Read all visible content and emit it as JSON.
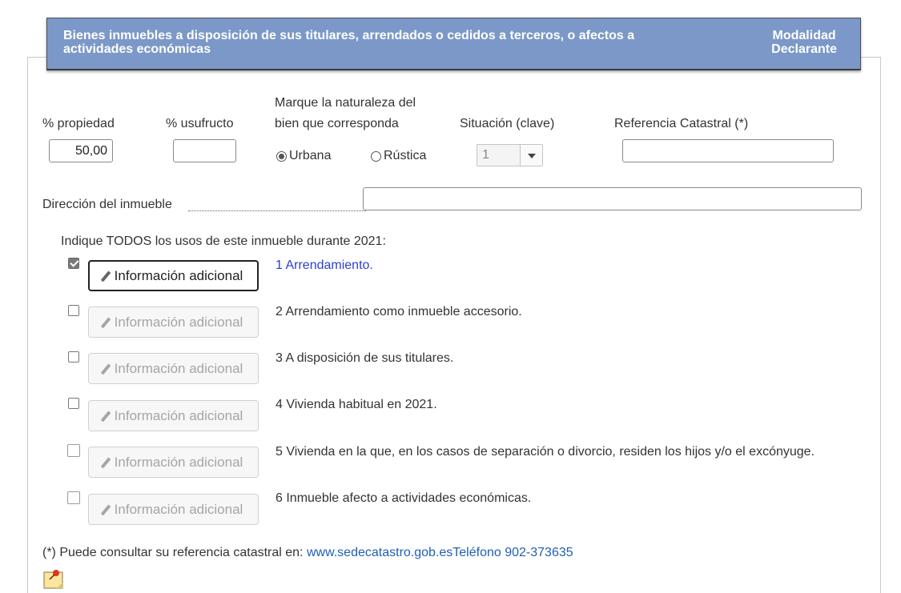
{
  "header": {
    "title": "Bienes inmuebles a disposición de sus titulares, arrendados o cedidos a terceros, o afectos a actividades económicas",
    "modalidad_line1": "Modalidad",
    "modalidad_line2": "Declarante"
  },
  "fields": {
    "propiedad_label": "% propiedad",
    "propiedad_value": "50,00",
    "usufructo_label": "% usufructo",
    "usufructo_value": "",
    "naturaleza_label_1": "Marque la naturaleza del",
    "naturaleza_label_2": "bien que corresponda",
    "radio_urbana": "Urbana",
    "radio_rustica": "Rústica",
    "radio_selected": "Urbana",
    "situacion_label": "Situación (clave)",
    "situacion_value": "1",
    "referencia_label": "Referencia Catastral (*)",
    "referencia_value": "",
    "direccion_label": "Dirección del inmueble",
    "direccion_value": ""
  },
  "usos": {
    "heading": "Indique TODOS los usos de este inmueble durante 2021:",
    "button_label": "Información adicional",
    "items": [
      {
        "label": "1 Arrendamiento.",
        "checked": true
      },
      {
        "label": "2 Arrendamiento como inmueble accesorio.",
        "checked": false
      },
      {
        "label": "3 A disposición de sus titulares.",
        "checked": false
      },
      {
        "label": "4 Vivienda habitual en 2021.",
        "checked": false
      },
      {
        "label": "5 Vivienda en la que, en los casos de separación o divorcio, residen los hijos y/o el excónyuge.",
        "checked": false
      },
      {
        "label": "6 Inmueble afecto a actividades económicas.",
        "checked": false
      }
    ]
  },
  "footer": {
    "text": "(*) Puede consultar su referencia catastral en: ",
    "link": "www.sedecatastro.gob.es",
    "phone": "Teléfono 902-373635"
  },
  "icons": {
    "note": "sticky-note-pin-icon",
    "pencil": "pencil-icon"
  }
}
